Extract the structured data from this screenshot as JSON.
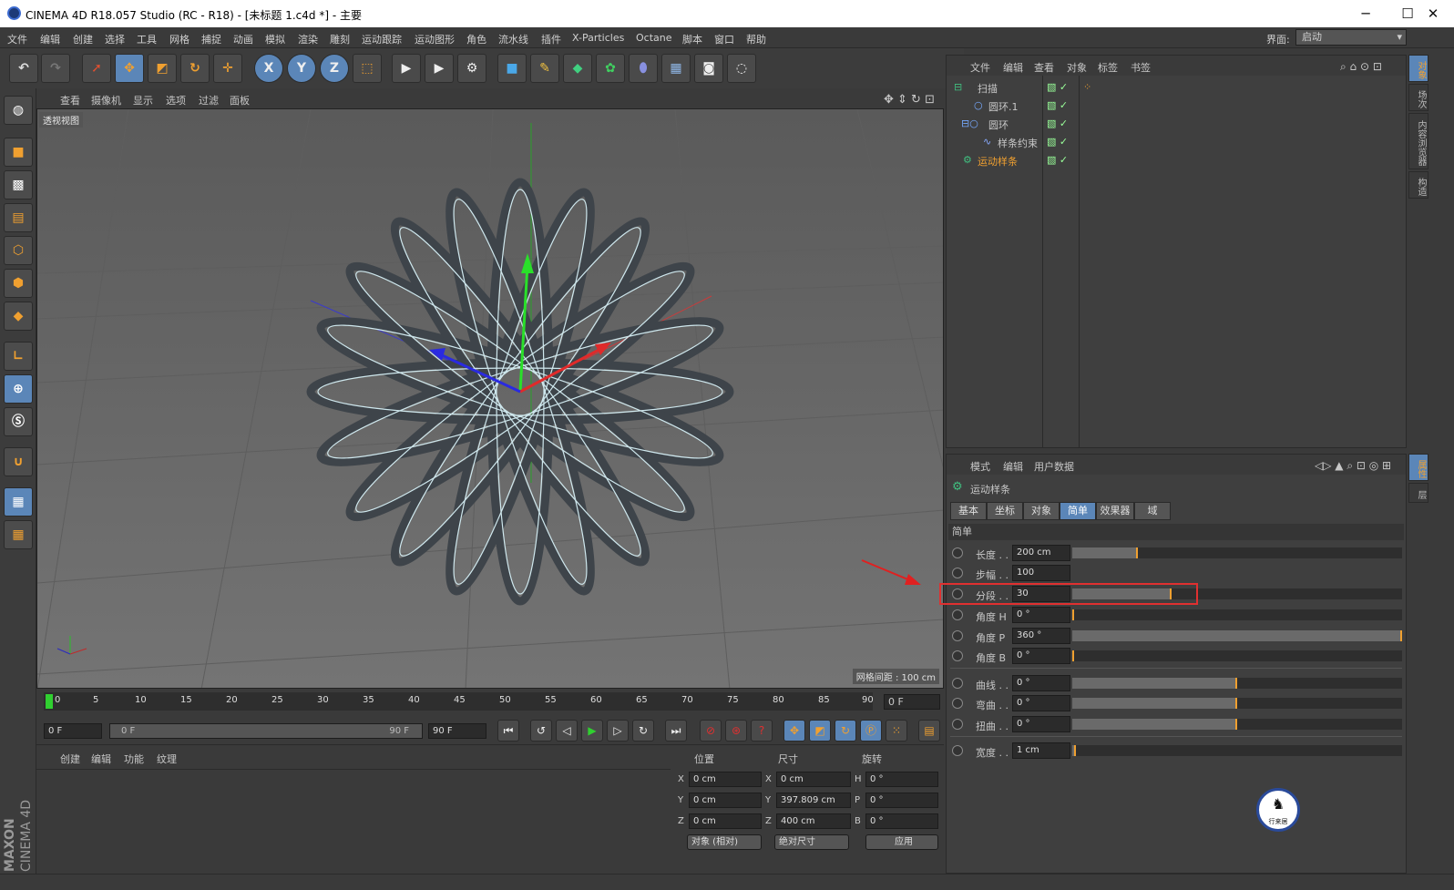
{
  "window": {
    "title": "CINEMA 4D R18.057 Studio (RC - R18) - [未标题 1.c4d *] - 主要",
    "minimize": "─",
    "maximize": "☐",
    "close": "✕"
  },
  "menubar": {
    "items": [
      "文件",
      "编辑",
      "创建",
      "选择",
      "工具",
      "网格",
      "捕捉",
      "动画",
      "模拟",
      "渲染",
      "雕刻",
      "运动跟踪",
      "运动图形",
      "角色",
      "流水线",
      "插件",
      "X-Particles",
      "Octane",
      "脚本",
      "窗口",
      "帮助"
    ],
    "layout_label": "界面:",
    "layout_value": "启动"
  },
  "toolbar": {
    "axis_x": "X",
    "axis_y": "Y",
    "axis_z": "Z"
  },
  "viewport": {
    "menu": [
      "查看",
      "摄像机",
      "显示",
      "选项",
      "过滤",
      "面板"
    ],
    "label": "透视视图",
    "grid_info": "网格间距 : 100 cm"
  },
  "timeline": {
    "ticks": [
      "0",
      "5",
      "10",
      "15",
      "20",
      "25",
      "30",
      "35",
      "40",
      "45",
      "50",
      "55",
      "60",
      "65",
      "70",
      "75",
      "80",
      "85",
      "90"
    ],
    "current_frame": "0 F",
    "start": "0 F",
    "range_start": "0 F",
    "range_end": "90 F",
    "end": "90 F"
  },
  "material": {
    "menu": [
      "创建",
      "编辑",
      "功能",
      "纹理"
    ]
  },
  "coords": {
    "headers": [
      "位置",
      "尺寸",
      "旋转"
    ],
    "rows": [
      {
        "axis_a": "X",
        "pos": "0 cm",
        "axis_b": "X",
        "size": "0 cm",
        "axis_c": "H",
        "rot": "0 °"
      },
      {
        "axis_a": "Y",
        "pos": "0 cm",
        "axis_b": "Y",
        "size": "397.809 cm",
        "axis_c": "P",
        "rot": "0 °"
      },
      {
        "axis_a": "Z",
        "pos": "0 cm",
        "axis_b": "Z",
        "size": "400 cm",
        "axis_c": "B",
        "rot": "0 °"
      }
    ],
    "mode": "对象 (相对)",
    "size_mode": "绝对尺寸",
    "apply": "应用"
  },
  "object_manager": {
    "menu": [
      "文件",
      "编辑",
      "查看",
      "对象",
      "标签",
      "书签"
    ],
    "objects": [
      {
        "name": "扫描",
        "indent": 0,
        "active": false
      },
      {
        "name": "圆环.1",
        "indent": 1,
        "active": false
      },
      {
        "name": "圆环",
        "indent": 1,
        "active": false
      },
      {
        "name": "样条约束",
        "indent": 2,
        "active": false
      },
      {
        "name": "运动样条",
        "indent": 0,
        "active": true
      }
    ],
    "side_tabs": [
      "对象",
      "场次",
      "内容浏览器",
      "构造"
    ]
  },
  "attributes": {
    "menu": [
      "模式",
      "编辑",
      "用户数据"
    ],
    "object_name": "运动样条",
    "tabs": [
      "基本",
      "坐标",
      "对象",
      "简单",
      "效果器",
      "域"
    ],
    "active_tab": "简单",
    "section": "简单",
    "side_tabs": [
      "属性",
      "层"
    ],
    "params": [
      {
        "label": "长度 . .",
        "value": "200 cm",
        "level": 0.2
      },
      {
        "label": "步幅 . . .",
        "value": "100",
        "level": null
      },
      {
        "label": "分段 . . .",
        "value": "30",
        "level": 0.3
      },
      {
        "label": "角度 H",
        "value": "0 °",
        "level": 0.0
      },
      {
        "label": "角度 P",
        "value": "360 °",
        "level": 1.0
      },
      {
        "label": "角度 B",
        "value": "0 °",
        "level": 0.0
      },
      {
        "label": "曲线 . .",
        "value": "0 °",
        "level": 0.5
      },
      {
        "label": "弯曲 . .",
        "value": "0 °",
        "level": 0.5
      },
      {
        "label": "扭曲 . .",
        "value": "0 °",
        "level": 0.5
      },
      {
        "label": "宽度 . .",
        "value": "1 cm",
        "level": 0.01
      }
    ],
    "highlight_color": "#e03030"
  },
  "brand": {
    "maxon": "MAXON",
    "product": "CINEMA 4D",
    "watermark": "行来居"
  }
}
